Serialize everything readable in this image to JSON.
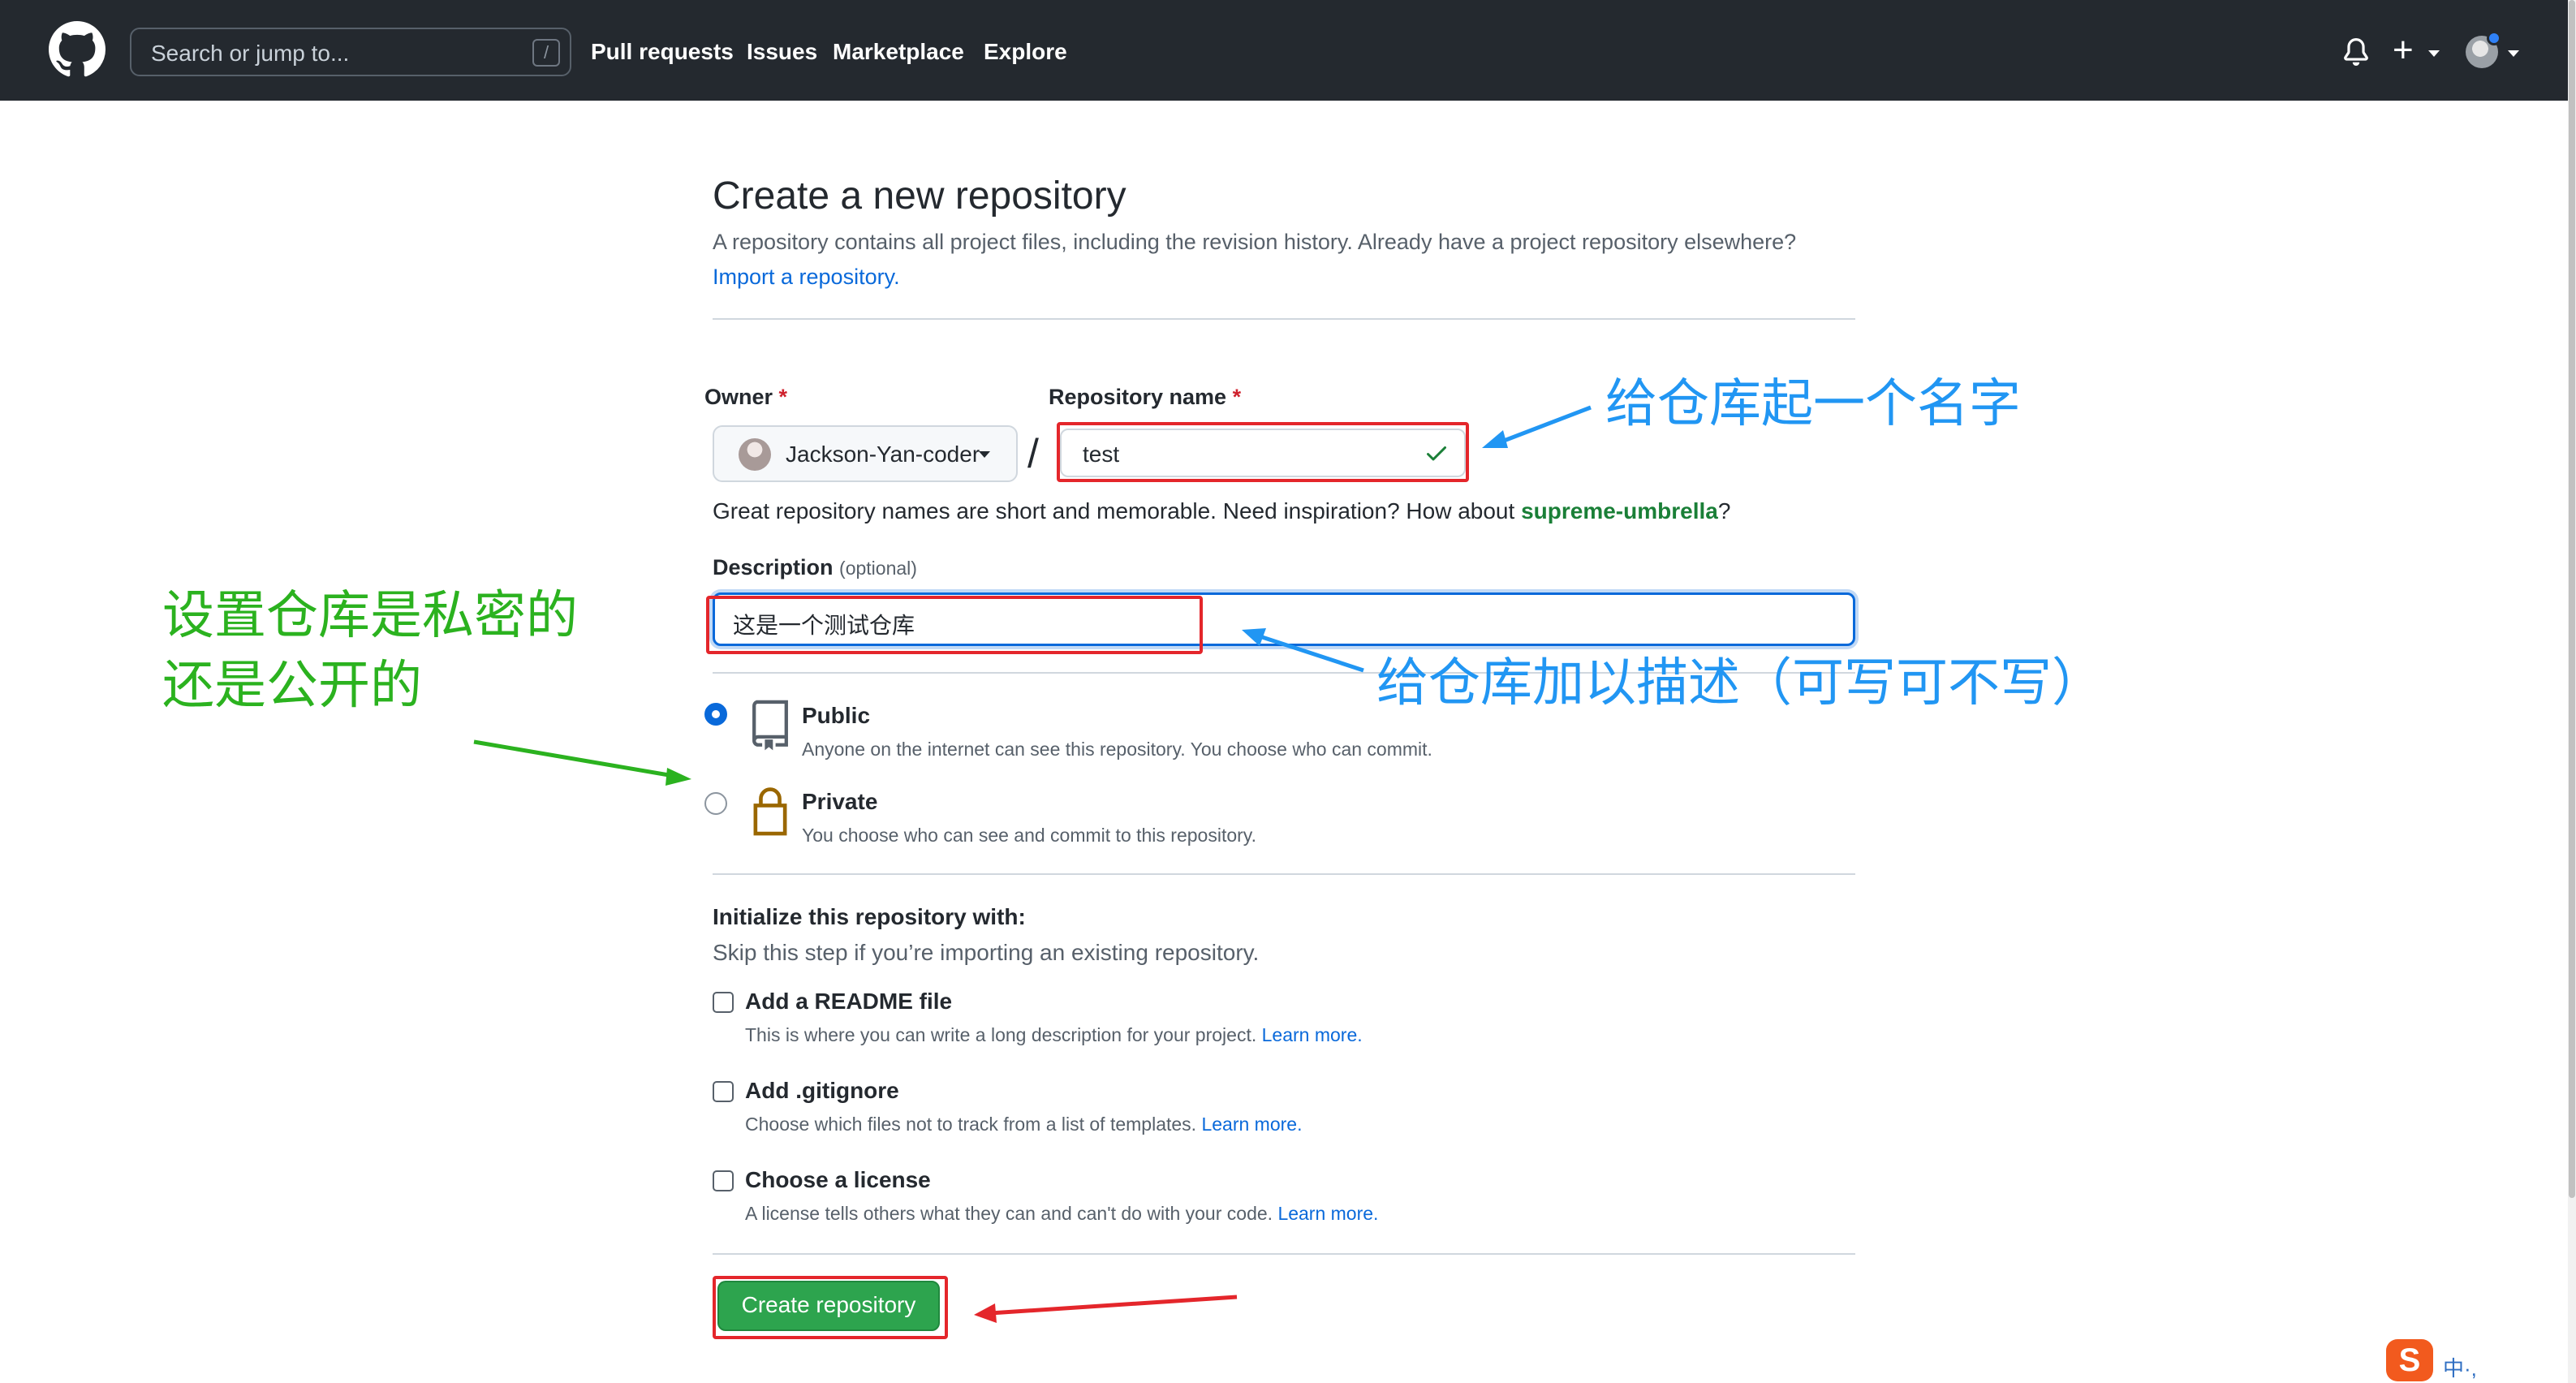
{
  "header": {
    "search_placeholder": "Search or jump to...",
    "search_key": "/",
    "nav": [
      "Pull requests",
      "Issues",
      "Marketplace",
      "Explore"
    ],
    "plus_label": "+"
  },
  "page": {
    "title": "Create a new repository",
    "subtitle": "A repository contains all project files, including the revision history. Already have a project repository elsewhere?",
    "import_link": "Import a repository."
  },
  "form": {
    "owner_label": "Owner",
    "required_mark": "*",
    "owner_value": "Jackson-Yan-coder",
    "slash": "/",
    "repo_label": "Repository name",
    "repo_value": "test",
    "hint_prefix": "Great repository names are short and memorable. Need inspiration? How about ",
    "hint_suggestion": "supreme-umbrella",
    "hint_suffix": "?",
    "desc_label": "Description",
    "desc_optional": "(optional)",
    "desc_value": "这是一个测试仓库"
  },
  "visibility": {
    "selected": "public",
    "public_title": "Public",
    "public_desc": "Anyone on the internet can see this repository. You choose who can commit.",
    "private_title": "Private",
    "private_desc": "You choose who can see and commit to this repository."
  },
  "init": {
    "title": "Initialize this repository with:",
    "subtitle": "Skip this step if you’re importing an existing repository.",
    "options": [
      {
        "title": "Add a README file",
        "desc": "This is where you can write a long description for your project.",
        "learn": "Learn more.",
        "checked": false
      },
      {
        "title": "Add .gitignore",
        "desc": "Choose which files not to track from a list of templates.",
        "learn": "Learn more.",
        "checked": false
      },
      {
        "title": "Choose a license",
        "desc": "A license tells others what they can and can't do with your code.",
        "learn": "Learn more.",
        "checked": false
      }
    ]
  },
  "create_button": "Create repository",
  "annotations": {
    "name": "给仓库起一个名字",
    "description": "给仓库加以描述（可写可不写）",
    "visibility_line1": "设置仓库是私密的",
    "visibility_line2": "还是公开的"
  },
  "taskbar": {
    "sogou_icon": "S",
    "ime_text": "中·,"
  },
  "colors": {
    "header_bg": "#24292f",
    "link": "#0969da",
    "primary_button": "#2da44e",
    "annotation_red": "#e4262b",
    "annotation_blue": "#2196f3",
    "annotation_green": "#2bb21f"
  }
}
